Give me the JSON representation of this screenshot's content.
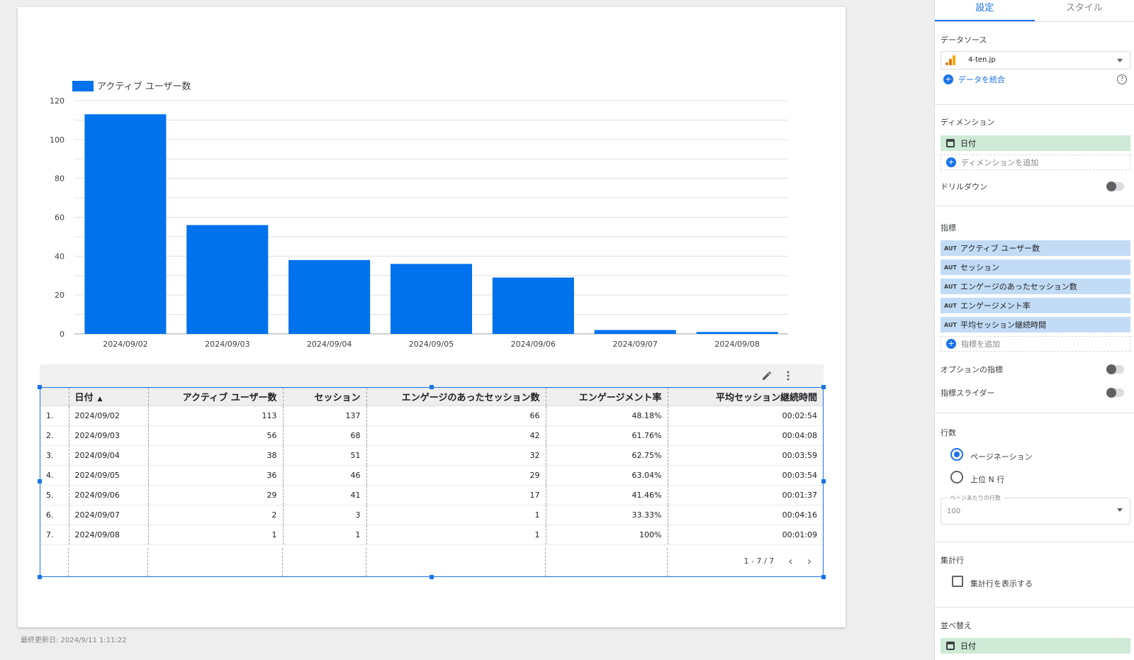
{
  "report": {
    "last_updated": "最終更新日: 2024/9/11 1:11:22"
  },
  "chart_data": {
    "type": "bar",
    "legend": [
      "アクティブ ユーザー数"
    ],
    "legend_position": "top-left",
    "categories": [
      "2024/09/02",
      "2024/09/03",
      "2024/09/04",
      "2024/09/05",
      "2024/09/06",
      "2024/09/07",
      "2024/09/08"
    ],
    "series": [
      {
        "name": "アクティブ ユーザー数",
        "values": [
          113,
          56,
          38,
          36,
          29,
          2,
          1
        ],
        "color": "#0072ec"
      }
    ],
    "yticks": [
      "0",
      "20",
      "40",
      "60",
      "80",
      "100",
      "120"
    ],
    "ylim": [
      0,
      120
    ],
    "grid": true
  },
  "table": {
    "headers": [
      "日付",
      "アクティブ ユーザー数",
      "セッション",
      "エンゲージのあったセッション数",
      "エンゲージメント率",
      "平均セッション継続時間"
    ],
    "sort_indicator": "▲",
    "rows": [
      {
        "idx": "1.",
        "date": "2024/09/02",
        "users": "113",
        "sessions": "137",
        "engaged": "66",
        "rate": "48.18%",
        "duration": "00:02:54"
      },
      {
        "idx": "2.",
        "date": "2024/09/03",
        "users": "56",
        "sessions": "68",
        "engaged": "42",
        "rate": "61.76%",
        "duration": "00:04:08"
      },
      {
        "idx": "3.",
        "date": "2024/09/04",
        "users": "38",
        "sessions": "51",
        "engaged": "32",
        "rate": "62.75%",
        "duration": "00:03:59"
      },
      {
        "idx": "4.",
        "date": "2024/09/05",
        "users": "36",
        "sessions": "46",
        "engaged": "29",
        "rate": "63.04%",
        "duration": "00:03:54"
      },
      {
        "idx": "5.",
        "date": "2024/09/06",
        "users": "29",
        "sessions": "41",
        "engaged": "17",
        "rate": "41.46%",
        "duration": "00:01:37"
      },
      {
        "idx": "6.",
        "date": "2024/09/07",
        "users": "2",
        "sessions": "3",
        "engaged": "1",
        "rate": "33.33%",
        "duration": "00:04:16"
      },
      {
        "idx": "7.",
        "date": "2024/09/08",
        "users": "1",
        "sessions": "1",
        "engaged": "1",
        "rate": "100%",
        "duration": "00:01:09"
      }
    ],
    "pagination": "1 - 7 / 7",
    "icons": {
      "edit": "pencil-icon",
      "more": "more-vert-icon",
      "prev": "chevron-left-icon",
      "next": "chevron-right-icon"
    }
  },
  "panel": {
    "tabs": [
      "設定",
      "スタイル"
    ],
    "data_source": {
      "title": "データソース",
      "value": "4-ten.jp",
      "blend": "データを統合",
      "icon": "analytics-icon"
    },
    "dimension": {
      "title": "ディメンション",
      "chip": "日付",
      "add": "ディメンションを追加"
    },
    "drilldown": "ドリルダウン",
    "metrics": {
      "title": "指標",
      "badge": "AUT",
      "items": [
        "アクティブ ユーザー数",
        "セッション",
        "エンゲージのあったセッション数",
        "エンゲージメント率",
        "平均セッション継続時間"
      ],
      "add": "指標を追加"
    },
    "optional_metrics": "オプションの指標",
    "metric_slider": "指標スライダー",
    "rows": {
      "title": "行数",
      "pagination": "ページネーション",
      "top_n": "上位 N 行",
      "per_page_label": "ページあたりの行数",
      "per_page_value": "100"
    },
    "summary": {
      "title": "集計行",
      "show": "集計行を表示する"
    },
    "sort": {
      "title": "並べ替え",
      "chip": "日付"
    }
  }
}
